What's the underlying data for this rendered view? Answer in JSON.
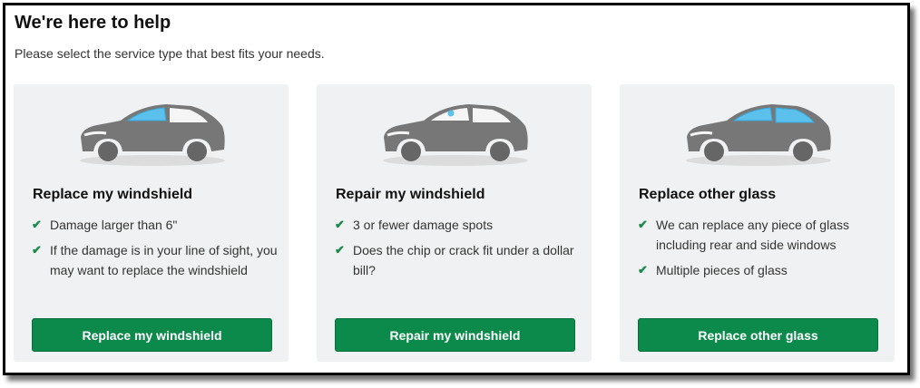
{
  "header": {
    "title": "We're here to help",
    "subtitle": "Please select the service type that best fits your needs."
  },
  "cards": [
    {
      "title": "Replace my windshield",
      "image_icon": "car-windshield-highlight-icon",
      "bullets": [
        "Damage larger than 6\"",
        "If the damage is in your line of sight, you may want to replace the windshield"
      ],
      "button": "Replace my windshield"
    },
    {
      "title": "Repair my windshield",
      "image_icon": "car-windshield-chip-icon",
      "bullets": [
        "3 or fewer damage spots",
        "Does the chip or crack fit under a dollar bill?"
      ],
      "button": "Repair my windshield"
    },
    {
      "title": "Replace other glass",
      "image_icon": "car-side-windows-highlight-icon",
      "bullets": [
        "We can replace any piece of glass including rear and side windows",
        "Multiple pieces of glass"
      ],
      "button": "Replace other glass"
    }
  ],
  "colors": {
    "button_green": "#0c8a4c",
    "check_green": "#1a8a4b",
    "card_bg": "#f0f1f2",
    "glass_blue": "#5bc0eb",
    "car_gray": "#777777"
  }
}
